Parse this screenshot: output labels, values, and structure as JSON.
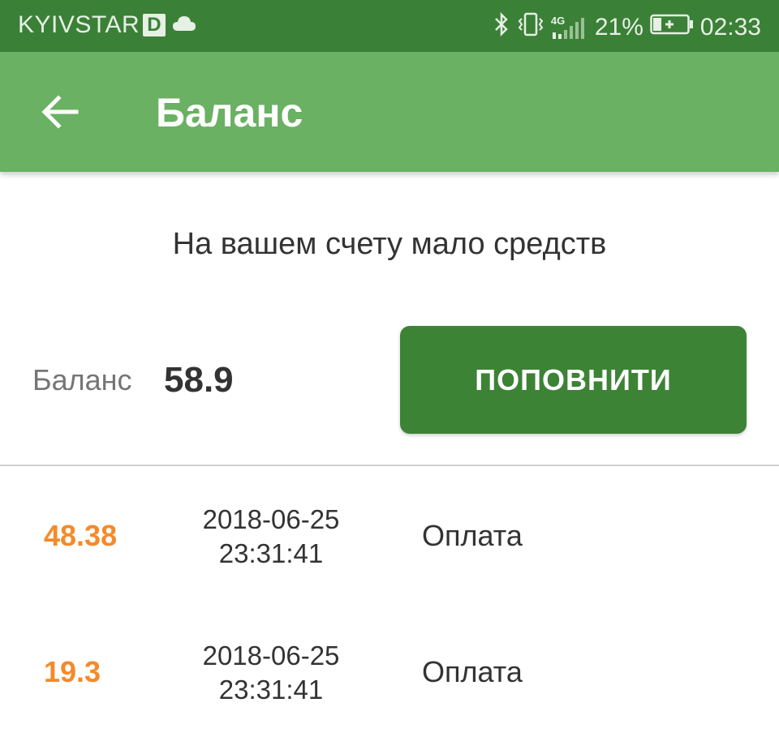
{
  "status_bar": {
    "carrier": "KYIVSTAR",
    "carrier_badge": "D",
    "network": "4G",
    "battery_percent": "21%",
    "time": "02:33",
    "icons": [
      "cloud-icon",
      "bluetooth-icon",
      "vibrate-icon",
      "signal-icon",
      "battery-charging-icon"
    ]
  },
  "app_bar": {
    "title": "Баланс",
    "back_icon": "arrow-left-icon"
  },
  "warning": "На вашем счету мало средств",
  "balance": {
    "label": "Баланс",
    "value": "58.9"
  },
  "topup_button": "ПОПОВНИТИ",
  "transactions": [
    {
      "amount": "48.38",
      "date": "2018-06-25",
      "time": "23:31:41",
      "type": "Оплата"
    },
    {
      "amount": "19.3",
      "date": "2018-06-25",
      "time": "23:31:41",
      "type": "Оплата"
    }
  ],
  "colors": {
    "status_bar": "#3b8037",
    "app_bar": "#6ab163",
    "button": "#3d8336",
    "amount": "#f58a2a"
  }
}
